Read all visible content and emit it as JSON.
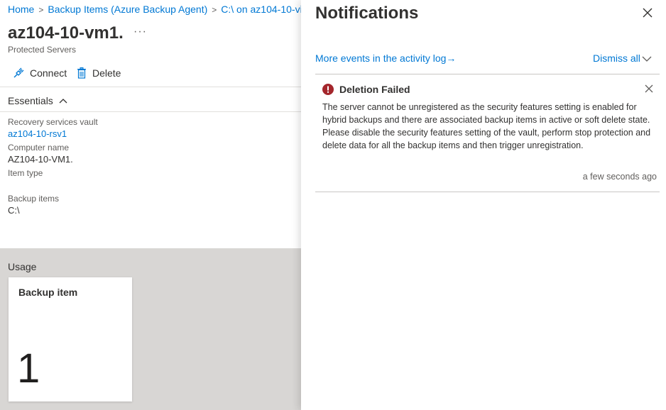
{
  "breadcrumb": {
    "items": [
      "Home",
      "Backup Items (Azure Backup Agent)",
      "C:\\ on az104-10-vi"
    ]
  },
  "page": {
    "title": "az104-10-vm1.",
    "more": "···",
    "subtitle": "Protected Servers"
  },
  "toolbar": {
    "connect_label": "Connect",
    "delete_label": "Delete"
  },
  "essentials": {
    "label": "Essentials",
    "properties": [
      {
        "label": "Recovery services vault",
        "value": "az104-10-rsv1"
      },
      {
        "label": "Computer name",
        "value": "AZ104-10-VM1."
      },
      {
        "label": "Item type",
        "value": ""
      },
      {
        "label": "Backup items",
        "value": "C:\\"
      }
    ]
  },
  "usage": {
    "title": "Usage",
    "tile": {
      "title": "Backup item",
      "value": "1"
    }
  },
  "notifications": {
    "title": "Notifications",
    "activity_link": "More events in the activity log",
    "activity_arrow": "→",
    "dismiss_all": "Dismiss all",
    "items": [
      {
        "title": "Deletion Failed",
        "body": "The server cannot be unregistered as the security features setting is enabled for hybrid backups and there are associated backup items in active or soft delete state. Please disable the security features setting of the vault, perform stop protection and delete data for all the backup items and then trigger unregistration.",
        "time": "a few seconds ago",
        "status_color": "#a4262c"
      }
    ]
  },
  "colors": {
    "link": "#0078d4",
    "error": "#a4262c",
    "usage_bg": "#d8d6d4"
  }
}
